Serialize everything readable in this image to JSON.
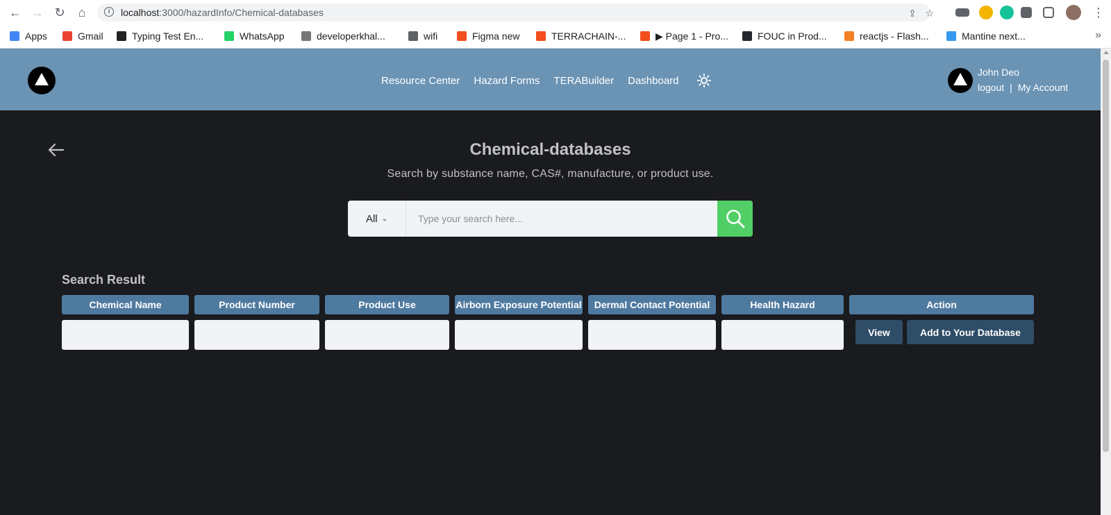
{
  "browser": {
    "url_host": "localhost",
    "url_path": ":3000/hazardInfo/Chemical-databases",
    "bookmarks": [
      {
        "label": "Apps",
        "color": "#4285f4"
      },
      {
        "label": "Gmail",
        "color": "#ea4335"
      },
      {
        "label": "Typing Test En...",
        "color": "#222222"
      },
      {
        "label": "WhatsApp",
        "color": "#25d366"
      },
      {
        "label": "developerkhal...",
        "color": "#777777"
      },
      {
        "label": "wifi",
        "color": "#5f6368"
      },
      {
        "label": "Figma new",
        "color": "#f24e1e"
      },
      {
        "label": "TERRACHAIN-...",
        "color": "#f24e1e"
      },
      {
        "label": "▶ Page 1 - Pro...",
        "color": "#f24e1e"
      },
      {
        "label": "FOUC in Prod...",
        "color": "#24292e"
      },
      {
        "label": "reactjs - Flash...",
        "color": "#f48024"
      },
      {
        "label": "Mantine next...",
        "color": "#339af0"
      }
    ],
    "more_label": "»"
  },
  "header": {
    "nav": [
      "Resource Center",
      "Hazard Forms",
      "TERABuilder",
      "Dashboard"
    ],
    "user_name": "John Deo",
    "logout": "logout",
    "separator": "|",
    "my_account": "My Account",
    "bg_color": "#6a93b4"
  },
  "main": {
    "title": "Chemical-databases",
    "subtitle": "Search by substance name, CAS#, manufacture, or product use.",
    "search": {
      "filter_value": "All",
      "placeholder": "Type your search here...",
      "button_color": "#51cf66"
    },
    "results_title": "Search Result",
    "columns": [
      "Chemical Name",
      "Product Number",
      "Product Use",
      "Airborn Exposure Potential",
      "Dermal Contact Potential",
      "Health Hazard",
      "Action"
    ],
    "actions": {
      "view": "View",
      "add": "Add to Your Database"
    }
  }
}
